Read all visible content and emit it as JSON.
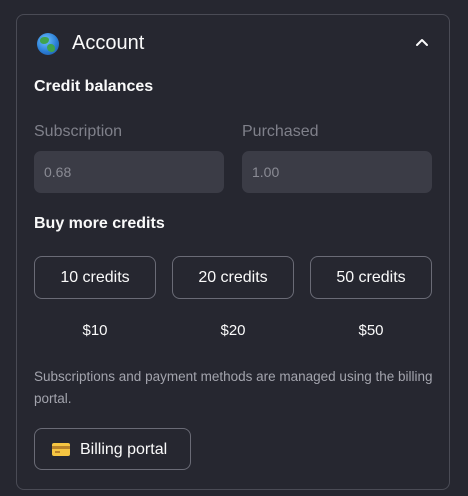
{
  "account": {
    "title": "Account",
    "globe_icon": "globe-icon",
    "collapse_icon": "chevron-up-icon"
  },
  "credit_balances": {
    "heading": "Credit balances",
    "subscription": {
      "label": "Subscription",
      "value": "0.68"
    },
    "purchased": {
      "label": "Purchased",
      "value": "1.00"
    }
  },
  "buy_credits": {
    "heading": "Buy more credits",
    "options": [
      {
        "label": "10 credits",
        "price": "$10"
      },
      {
        "label": "20 credits",
        "price": "$20"
      },
      {
        "label": "50 credits",
        "price": "$50"
      }
    ]
  },
  "billing": {
    "note": "Subscriptions and payment methods are managed using the billing portal.",
    "button_label": "Billing portal",
    "button_icon": "credit-card-icon"
  },
  "colors": {
    "background": "#262730",
    "border": "#4a4b55",
    "input_bg": "#3b3c46",
    "text": "#fafafa",
    "muted": "#7f808a"
  }
}
